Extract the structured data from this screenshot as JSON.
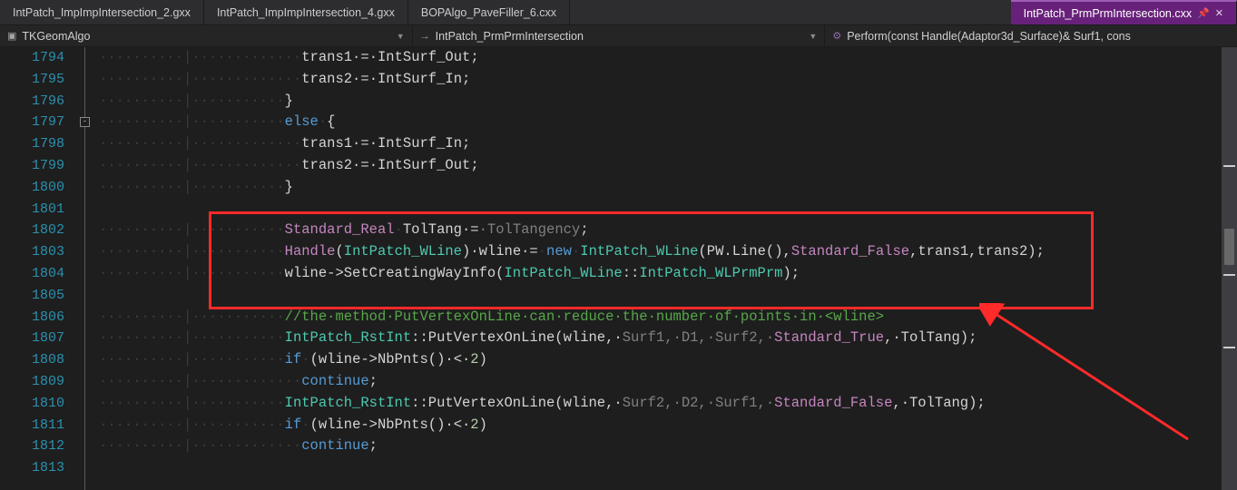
{
  "tabs": {
    "t0": "IntPatch_ImpImpIntersection_2.gxx",
    "t1": "IntPatch_ImpImpIntersection_4.gxx",
    "t2": "BOPAlgo_PaveFiller_6.cxx",
    "t3": "IntPatch_PrmPrmIntersection.cxx"
  },
  "nav": {
    "project": "TKGeomAlgo",
    "file": "IntPatch_PrmPrmIntersection",
    "func": "Perform(const Handle(Adaptor3d_Surface)& Surf1, cons"
  },
  "gutter": {
    "start": 1794,
    "count": 20
  },
  "code": {
    "l0": {
      "ws": "··········|·············",
      "t1": "trans1·",
      "op": "=",
      "t2": "·IntSurf_Out",
      ";": ";"
    },
    "l1": {
      "ws": "··········|·············",
      "t1": "trans2·",
      "op": "=",
      "t2": "·IntSurf_In",
      ";": ";"
    },
    "l2": {
      "ws": "··········|···········",
      "brace": "}"
    },
    "l3": {
      "ws": "··········|···········",
      "kw": "else",
      "sp": "·",
      "brace": "{"
    },
    "l4": {
      "ws": "··········|·············",
      "t1": "trans1·",
      "op": "=",
      "t2": "·IntSurf_In",
      ";": ";"
    },
    "l5": {
      "ws": "··········|·············",
      "t1": "trans2·",
      "op": "=",
      "t2": "·IntSurf_Out",
      ";": ";"
    },
    "l6": {
      "ws": "··········|···········",
      "brace": "}"
    },
    "l7": {
      "ws": ""
    },
    "l8": {
      "ws": "··········|···········",
      "type": "Standard_Real",
      "sp": "·",
      "name": "TolTang·",
      "op": "=",
      "ghost": "·TolTangency",
      ";": ";"
    },
    "l9": {
      "ws": "··········|···········",
      "hdl": "Handle",
      "p1": "(",
      "cls": "IntPatch_WLine",
      "p2": ")·",
      "name": "wline·",
      "op": "=",
      "sp": "·",
      "kw": "new",
      "sp2": "·",
      "cls2": "IntPatch_WLine",
      "args": "(PW.Line(),",
      "bool": "Standard_False",
      "args2": ",trans1,trans2);"
    },
    "l10": {
      "ws": "··········|···········",
      "obj": "wline->SetCreatingWayInfo(",
      "cls": "IntPatch_WLine",
      "dc": "::",
      "enum": "IntPatch_WLPrmPrm",
      "end": ");"
    },
    "l11": {
      "ws": ""
    },
    "l12": {
      "ws": "··········|···········",
      "cm": "//the·method·PutVertexOnLine·can·reduce·the·number·of·points·in·<wline>"
    },
    "l13": {
      "ws": "··········|···········",
      "cls": "IntPatch_RstInt",
      "dc": "::",
      "fn": "PutVertexOnLine(wline,·",
      "p": "Surf1,·D1,·Surf2,·",
      "bool": "Standard_True",
      "end": ",·TolTang);"
    },
    "l14": {
      "ws": "··········|···········",
      "kw": "if",
      "sp": "·",
      "args": "(wline->NbPnts()·<·",
      "num": "2",
      "end": ")"
    },
    "l15": {
      "ws": "··········|·············",
      "kw": "continue",
      ";": ";"
    },
    "l16": {
      "ws": "··········|···········",
      "cls": "IntPatch_RstInt",
      "dc": "::",
      "fn": "PutVertexOnLine(wline,·",
      "p": "Surf2,·D2,·Surf1,·",
      "bool": "Standard_False",
      "end": ",·TolTang);"
    },
    "l17": {
      "ws": "··········|···········",
      "kw": "if",
      "sp": "·",
      "args": "(wline->NbPnts()·<·",
      "num": "2",
      "end": ")"
    },
    "l18": {
      "ws": "··········|·············",
      "kw": "continue",
      ";": ";"
    },
    "l19": {
      "ws": ""
    }
  },
  "icons": {
    "pin": "📌",
    "close": "✕",
    "arrow": "→",
    "method": "⚙"
  }
}
